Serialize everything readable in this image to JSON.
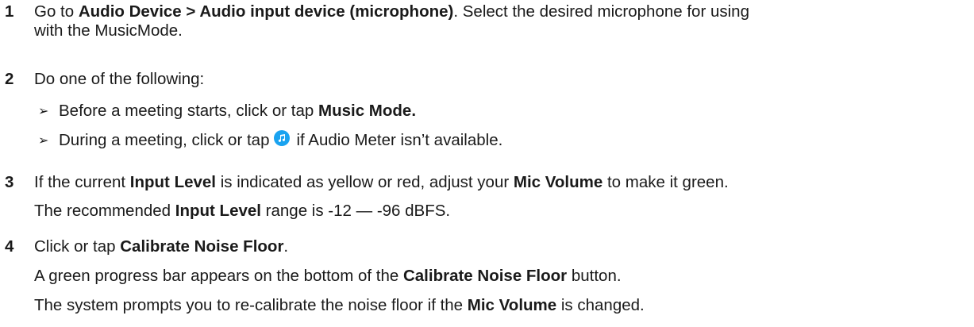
{
  "steps": [
    {
      "number": "1",
      "parts": {
        "p1": "Go to ",
        "b1": "Audio Device > Audio input device (microphone)",
        "p2": ". Select the desired microphone for using",
        "line2": "with the MusicMode."
      }
    },
    {
      "number": "2",
      "text": "Do one of the following:",
      "bullets": [
        {
          "arrow": "➢",
          "p1": "Before a meeting starts, click or tap ",
          "b1": "Music Mode."
        },
        {
          "arrow": "➢",
          "p1": "During a meeting, click or tap",
          "icon": "music-note-icon",
          "p2": "if Audio Meter isn’t available."
        }
      ]
    },
    {
      "number": "3",
      "parts": {
        "p1": "If the current ",
        "b1": "Input Level",
        "p2": " is indicated as yellow or red, adjust your ",
        "b2": "Mic Volume",
        "p3": " to make it green."
      },
      "note": {
        "p1": "The recommended ",
        "b1": "Input Level",
        "p2": " range is -12 — -96 dBFS."
      }
    },
    {
      "number": "4",
      "parts": {
        "p1": "Click or tap ",
        "b1": "Calibrate Noise Floor",
        "p2": "."
      },
      "notes": [
        {
          "p1": "A green progress bar appears on the bottom of the ",
          "b1": "Calibrate Noise Floor",
          "p2": " button."
        },
        {
          "p1": "The system prompts you to re-calibrate the noise floor if the ",
          "b1": "Mic Volume",
          "p2": " is changed."
        }
      ]
    }
  ],
  "colors": {
    "text": "#1a1a1a",
    "icon_bg": "#1aa3f0"
  }
}
